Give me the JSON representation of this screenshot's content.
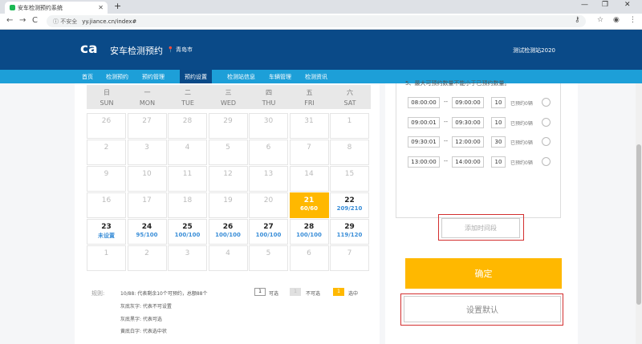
{
  "browser": {
    "tab_title": "安车检测预约系统",
    "new_tab": "+",
    "win_min": "—",
    "win_max": "❐",
    "win_close": "✕",
    "back": "←",
    "forward": "→",
    "reload": "C",
    "url_secure": "ⓘ 不安全",
    "url": "yy.jiance.cn/index#",
    "key_icon": "⚷",
    "star_icon": "☆",
    "account_icon": "◉",
    "menu_icon": "⋮"
  },
  "header": {
    "logo_mark": "ca",
    "logo_text": "安车检测预约",
    "city": "青岛市",
    "station": "测试检测站2020"
  },
  "nav": {
    "items": [
      {
        "label": "首页"
      },
      {
        "label": "检测预约"
      },
      {
        "label": "预约管理"
      },
      {
        "label": "预约设置"
      },
      {
        "label": "检测站信息"
      },
      {
        "label": "车辆管理"
      },
      {
        "label": "检测资讯"
      }
    ]
  },
  "calendar": {
    "weekdays": [
      {
        "cn": "日",
        "en": "SUN"
      },
      {
        "cn": "一",
        "en": "MON"
      },
      {
        "cn": "二",
        "en": "TUE"
      },
      {
        "cn": "三",
        "en": "WED"
      },
      {
        "cn": "四",
        "en": "THU"
      },
      {
        "cn": "五",
        "en": "FRI"
      },
      {
        "cn": "六",
        "en": "SAT"
      }
    ],
    "rows": [
      [
        {
          "d": "26"
        },
        {
          "d": "27"
        },
        {
          "d": "28"
        },
        {
          "d": "29"
        },
        {
          "d": "30"
        },
        {
          "d": "31"
        },
        {
          "d": "1"
        }
      ],
      [
        {
          "d": "2"
        },
        {
          "d": "3"
        },
        {
          "d": "4"
        },
        {
          "d": "5"
        },
        {
          "d": "6"
        },
        {
          "d": "7"
        },
        {
          "d": "8"
        }
      ],
      [
        {
          "d": "9"
        },
        {
          "d": "10"
        },
        {
          "d": "11"
        },
        {
          "d": "12"
        },
        {
          "d": "13"
        },
        {
          "d": "14"
        },
        {
          "d": "15"
        }
      ],
      [
        {
          "d": "16"
        },
        {
          "d": "17"
        },
        {
          "d": "18"
        },
        {
          "d": "19"
        },
        {
          "d": "20"
        },
        {
          "d": "21",
          "s": "60/60"
        },
        {
          "d": "22",
          "s": "209/210"
        }
      ],
      [
        {
          "d": "23",
          "s": "未设置"
        },
        {
          "d": "24",
          "s": "95/100"
        },
        {
          "d": "25",
          "s": "100/100"
        },
        {
          "d": "26",
          "s": "100/100"
        },
        {
          "d": "27",
          "s": "100/100"
        },
        {
          "d": "28",
          "s": "100/100"
        },
        {
          "d": "29",
          "s": "119/120"
        }
      ],
      [
        {
          "d": "1"
        },
        {
          "d": "2"
        },
        {
          "d": "3"
        },
        {
          "d": "4"
        },
        {
          "d": "5"
        },
        {
          "d": "6"
        },
        {
          "d": "7"
        }
      ]
    ]
  },
  "rules": {
    "label": "规则:",
    "lines": [
      "10/88: 代表剩余10个可预约，总额88个",
      "灰底灰字: 代表不可设置",
      "灰底黑字: 代表可选",
      "黄底白字: 代表选中状"
    ],
    "legend": [
      {
        "box": "1",
        "label": "可选"
      },
      {
        "box": "1",
        "label": "不可选"
      },
      {
        "box": "1",
        "label": "选中"
      }
    ]
  },
  "slots": {
    "tip": "5、最大可预约数量不能小于已预约数量。",
    "sep": "--",
    "items": [
      {
        "start": "08:00:00",
        "end": "09:00:00",
        "num": "10",
        "booked": "已预约0辆"
      },
      {
        "start": "09:00:01",
        "end": "09:30:00",
        "num": "10",
        "booked": "已预约0辆"
      },
      {
        "start": "09:30:01",
        "end": "12:00:00",
        "num": "30",
        "booked": "已预约0辆"
      },
      {
        "start": "13:00:00",
        "end": "14:00:00",
        "num": "10",
        "booked": "已预约0辆"
      }
    ],
    "add_label": "添加时间段",
    "confirm_label": "确定",
    "default_label": "设置默认"
  },
  "colors": {
    "header": "#0a4a88",
    "nav": "#1d9fd8",
    "accent": "#ffb800",
    "highlight": "#d32f2f"
  }
}
